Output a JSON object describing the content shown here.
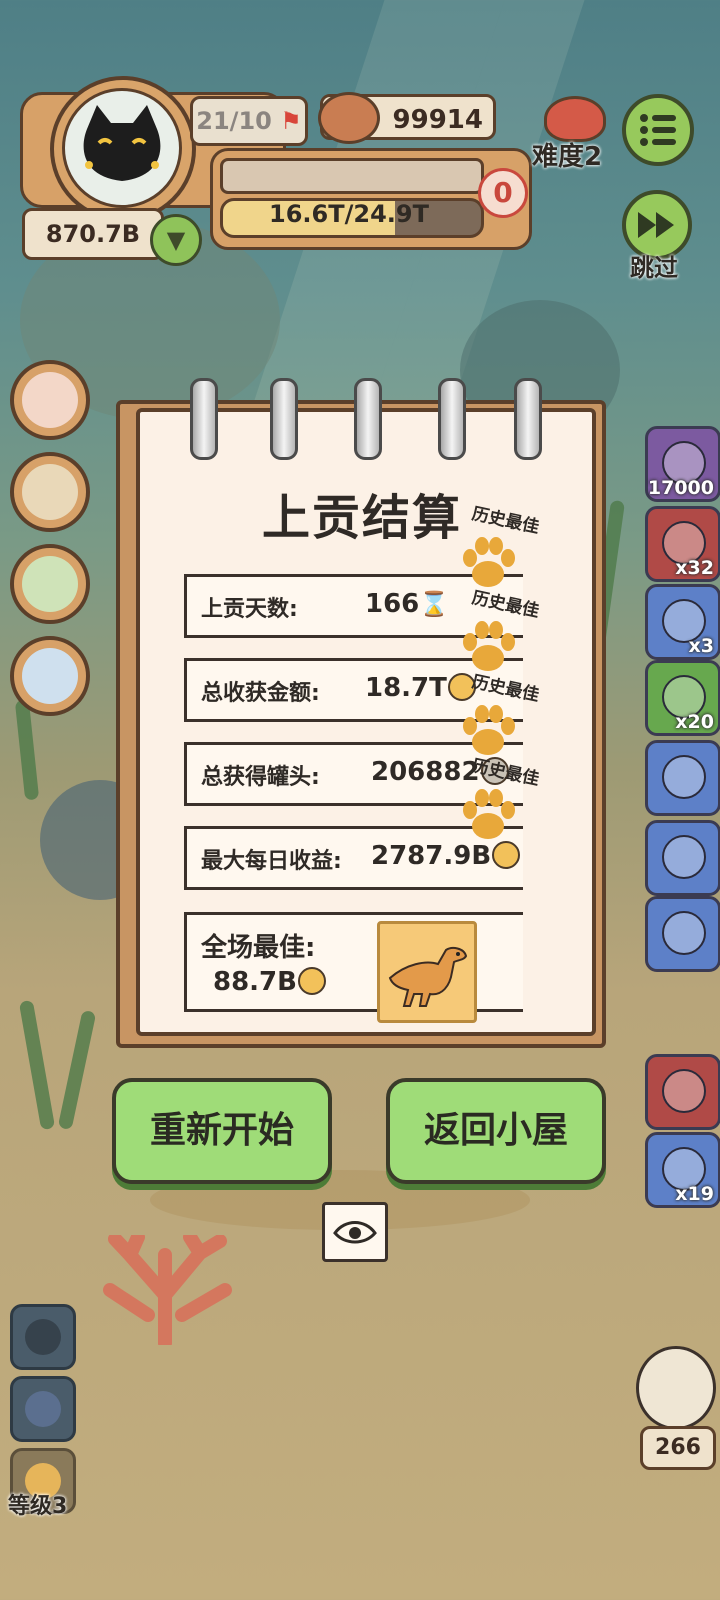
{
  "hud": {
    "progress_count": "21/10",
    "cans": "99914",
    "money": "870.7B",
    "goal_progress": "16.6T/24.9T",
    "danger_count": "0",
    "difficulty": "难度2",
    "skip_label": "跳过"
  },
  "dialog": {
    "title": "上贡结算",
    "rows": [
      {
        "label": "上贡天数:",
        "value": "166",
        "badge": "历史最佳"
      },
      {
        "label": "总收获金额:",
        "value": "18.7T",
        "badge": "历史最佳"
      },
      {
        "label": "总获得罐头:",
        "value": "206882",
        "badge": "历史最佳"
      },
      {
        "label": "最大每日收益:",
        "value": "2787.9B",
        "badge": "历史最佳"
      }
    ],
    "best_label": "全场最佳:",
    "best_value": "88.7B"
  },
  "buttons": {
    "restart": "重新开始",
    "home": "返回小屋"
  },
  "items": [
    {
      "icon": "bait-icon",
      "count": "17000",
      "color": "#7c5aa0"
    },
    {
      "icon": "bag-icon",
      "count": "x32",
      "color": "#b04a47"
    },
    {
      "icon": "donut-icon",
      "count": "x3",
      "color": "#5d80c8"
    },
    {
      "icon": "tent-icon",
      "count": "x20",
      "color": "#67a84e"
    },
    {
      "icon": "jar-icon",
      "count": "",
      "color": "#5d80c8"
    },
    {
      "icon": "cookie-plus-icon",
      "count": "",
      "color": "#5d80c8"
    },
    {
      "icon": "camera-icon",
      "count": "",
      "color": "#5d80c8"
    },
    {
      "icon": "shell-icon",
      "count": "",
      "color": "#b04a47"
    },
    {
      "icon": "charm-icon",
      "count": "x19",
      "color": "#5d80c8"
    }
  ],
  "bottom": {
    "level": "等级3",
    "fish_count": "266"
  }
}
